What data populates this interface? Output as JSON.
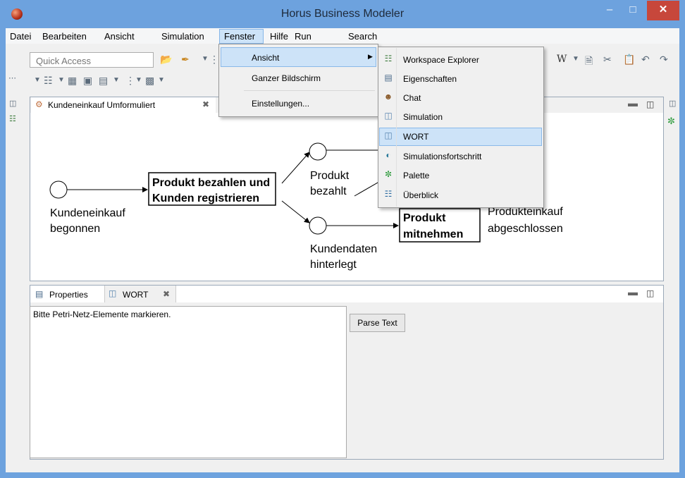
{
  "window": {
    "title": "Horus Business Modeler"
  },
  "menubar": [
    "Datei",
    "Bearbeiten",
    "Ansicht",
    "Simulation",
    "Fenster",
    "Hilfe",
    "Run",
    "Search"
  ],
  "toolbar": {
    "quick_access_placeholder": "Quick Access"
  },
  "editor": {
    "tab_label": "Kundeneinkauf Umformuliert",
    "diagram": {
      "start_label_1": "Kundeneinkauf",
      "start_label_2": "begonnen",
      "transition1_1": "Produkt bezahlen und",
      "transition1_2": "Kunden registrieren",
      "place_top_1": "Produkt",
      "place_top_2": "bezahlt",
      "place_bottom_1": "Kundendaten",
      "place_bottom_2": "hinterlegt",
      "transition2_1": "Produkt",
      "transition2_2": "mitnehmen",
      "end_label_1": "Produkteinkauf",
      "end_label_2": "abgeschlossen"
    }
  },
  "fenster_menu": {
    "items": [
      "Ansicht",
      "Ganzer Bildschirm",
      "Einstellungen..."
    ]
  },
  "ansicht_menu": {
    "items": [
      "Workspace Explorer",
      "Eigenschaften",
      "Chat",
      "Simulation",
      "WORT",
      "Simulationsfortschritt",
      "Palette",
      "Überblick"
    ],
    "highlighted": "WORT"
  },
  "bottom_panel": {
    "tabs": [
      "Properties",
      "WORT"
    ],
    "text": "Bitte Petri-Netz-Elemente markieren.",
    "parse_button": "Parse Text"
  },
  "colors": {
    "titlebar": "#6da2de",
    "menu_highlight": "#cde3f8",
    "close_button": "#c7473b"
  }
}
